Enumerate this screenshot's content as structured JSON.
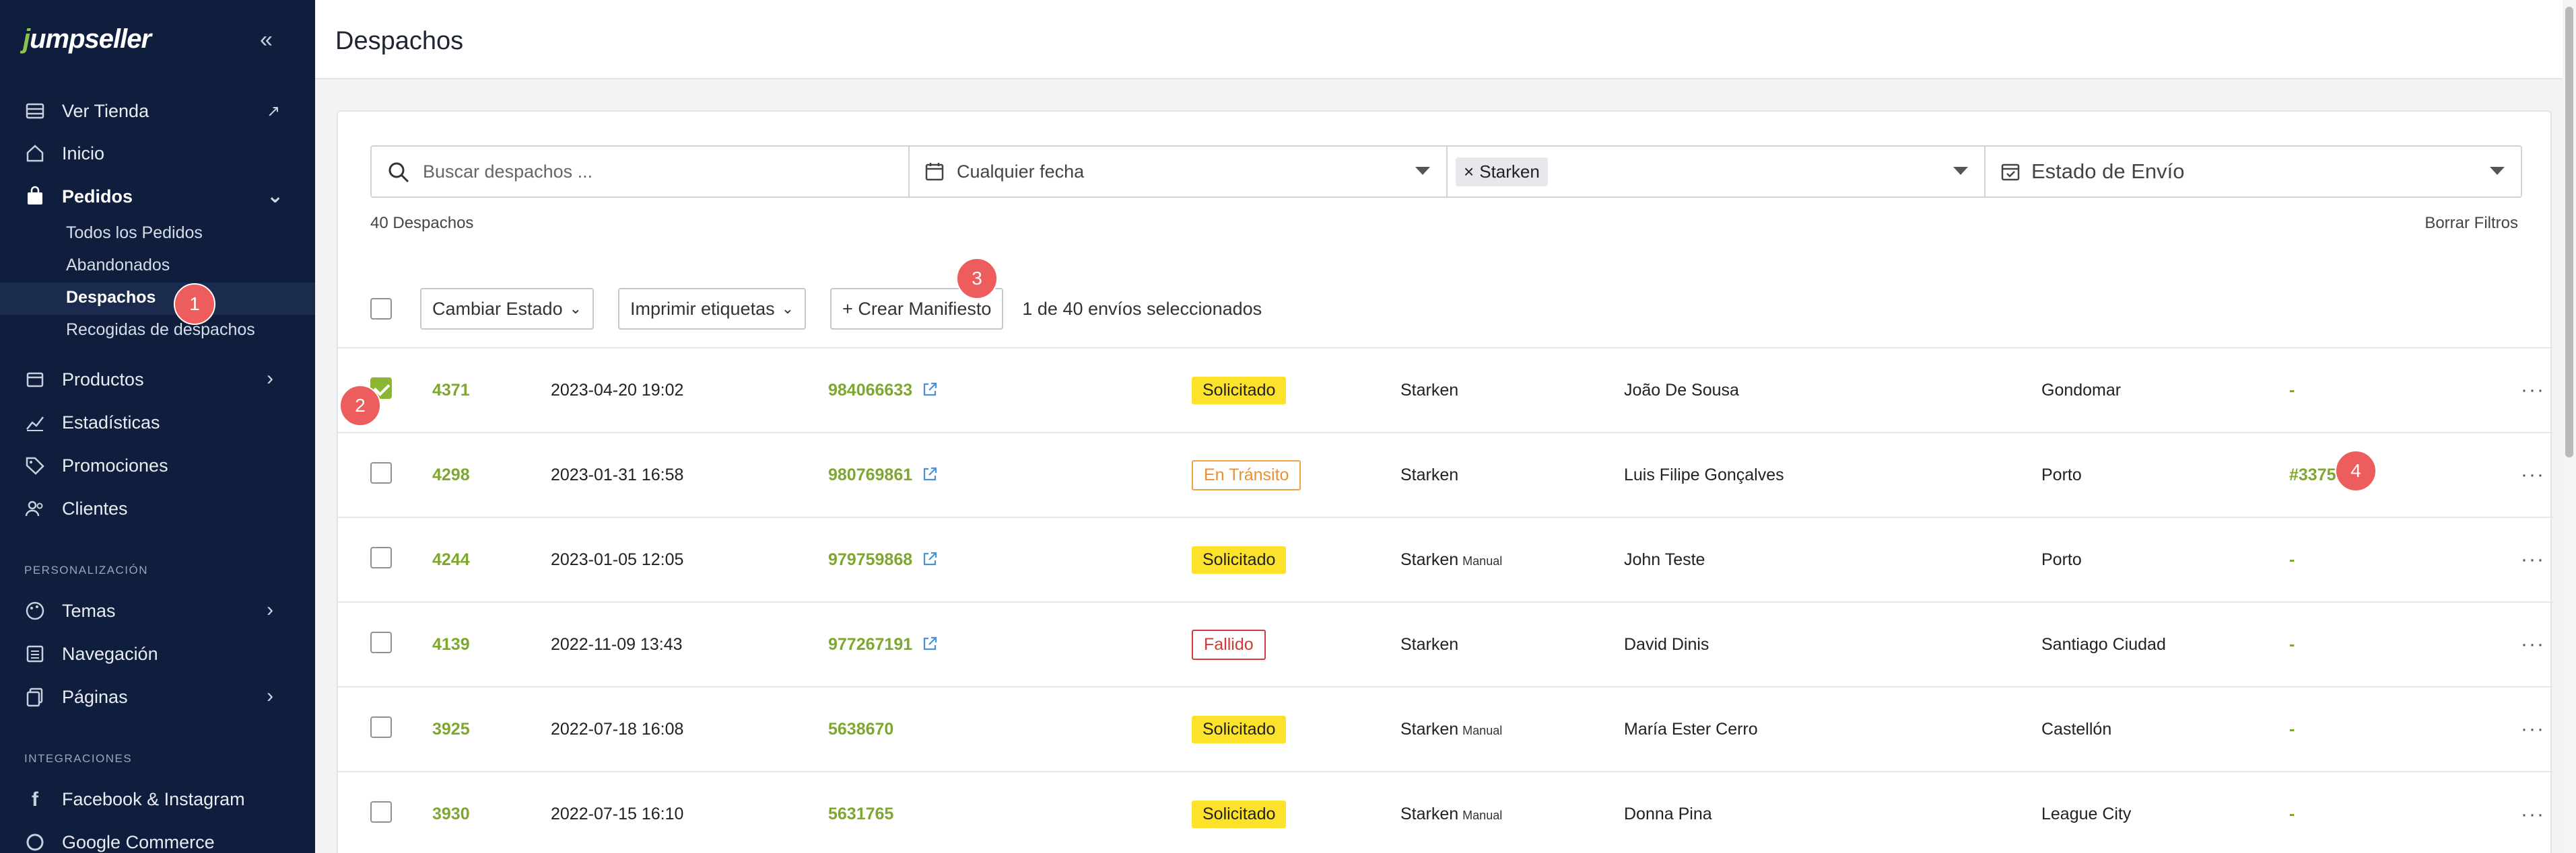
{
  "app": {
    "logo": "jumpseller"
  },
  "sidebar": {
    "items": [
      {
        "label": "Ver Tienda"
      },
      {
        "label": "Inicio"
      },
      {
        "label": "Pedidos"
      },
      {
        "label": "Productos"
      },
      {
        "label": "Estadísticas"
      },
      {
        "label": "Promociones"
      },
      {
        "label": "Clientes"
      },
      {
        "label": "Temas"
      },
      {
        "label": "Navegación"
      },
      {
        "label": "Páginas"
      },
      {
        "label": "Facebook & Instagram"
      },
      {
        "label": "Google Commerce"
      }
    ],
    "sub_items": [
      {
        "label": "Todos los Pedidos"
      },
      {
        "label": "Abandonados"
      },
      {
        "label": "Despachos"
      },
      {
        "label": "Recogidas de despachos"
      }
    ],
    "sections": {
      "personalizacion": "PERSONALIZACIÓN",
      "integraciones": "INTEGRACIONES"
    }
  },
  "header": {
    "title": "Despachos"
  },
  "filters": {
    "search_placeholder": "Buscar despachos ...",
    "date": "Cualquier fecha",
    "carrier_chip": "Starken",
    "status": "Estado de Envío"
  },
  "summary": {
    "count": "40 Despachos",
    "clear": "Borrar Filtros"
  },
  "toolbar": {
    "change_state": "Cambiar Estado",
    "print_labels": "Imprimir etiquetas",
    "create_manifest": "+ Crear Manifiesto",
    "selected": "1 de 40 envíos seleccionados"
  },
  "rows": [
    {
      "id": "4371",
      "date": "2023-04-20 19:02",
      "tracking": "984066633",
      "status": "Solicitado",
      "carrier": "Starken",
      "manual": "",
      "name": "João De Sousa",
      "city": "Gondomar",
      "pickup": "-",
      "checked": true
    },
    {
      "id": "4298",
      "date": "2023-01-31 16:58",
      "tracking": "980769861",
      "status": "En Tránsito",
      "carrier": "Starken",
      "manual": "",
      "name": "Luis Filipe Gonçalves",
      "city": "Porto",
      "pickup": "#3375",
      "checked": false
    },
    {
      "id": "4244",
      "date": "2023-01-05 12:05",
      "tracking": "979759868",
      "status": "Solicitado",
      "carrier": "Starken",
      "manual": "Manual",
      "name": "John Teste",
      "city": "Porto",
      "pickup": "-",
      "checked": false
    },
    {
      "id": "4139",
      "date": "2022-11-09 13:43",
      "tracking": "977267191",
      "status": "Fallido",
      "carrier": "Starken",
      "manual": "",
      "name": "David Dinis",
      "city": "Santiago Ciudad",
      "pickup": "-",
      "checked": false
    },
    {
      "id": "3925",
      "date": "2022-07-18 16:08",
      "tracking": "5638670",
      "status": "Solicitado",
      "carrier": "Starken",
      "manual": "Manual",
      "name": "María Ester Cerro",
      "city": "Castellón",
      "pickup": "-",
      "checked": false
    },
    {
      "id": "3930",
      "date": "2022-07-15 16:10",
      "tracking": "5631765",
      "status": "Solicitado",
      "carrier": "Starken",
      "manual": "Manual",
      "name": "Donna Pina",
      "city": "League City",
      "pickup": "-",
      "checked": false
    }
  ],
  "markers": [
    "1",
    "2",
    "3",
    "4"
  ],
  "colors": {
    "sidebar": "#0f1e3c",
    "accent_green": "#7ea82c",
    "badge_yellow": "#fce22b",
    "marker_red": "#ee5d5d"
  }
}
